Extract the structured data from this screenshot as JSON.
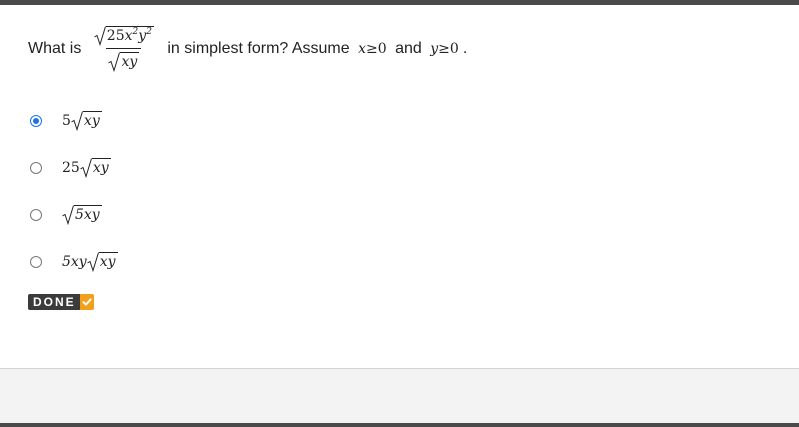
{
  "question": {
    "prefix": "What is ",
    "numerator": {
      "coef": "25",
      "var1": "x",
      "exp1": "2",
      "var2": "y",
      "exp2": "2"
    },
    "denominator": "xy",
    "middle": " in simplest form? Assume ",
    "cond1": {
      "var": "x",
      "op": "≥",
      "val": "0"
    },
    "joiner": " and ",
    "cond2": {
      "var": "y",
      "op": "≥",
      "val": "0"
    },
    "end": "."
  },
  "options": [
    {
      "coef": "5",
      "radicand": "xy",
      "selected": true
    },
    {
      "coef": "25",
      "radicand": "xy",
      "selected": false
    },
    {
      "coef": "",
      "radicand": "5xy",
      "selected": false
    },
    {
      "coef": "5xy",
      "radicand": "xy",
      "selected": false
    }
  ],
  "done": {
    "label": "DONE",
    "icon": "check-icon"
  },
  "colors": {
    "accent": "#1a73e8",
    "done_bg": "#3b3b3b",
    "done_check": "#f0a01a"
  }
}
